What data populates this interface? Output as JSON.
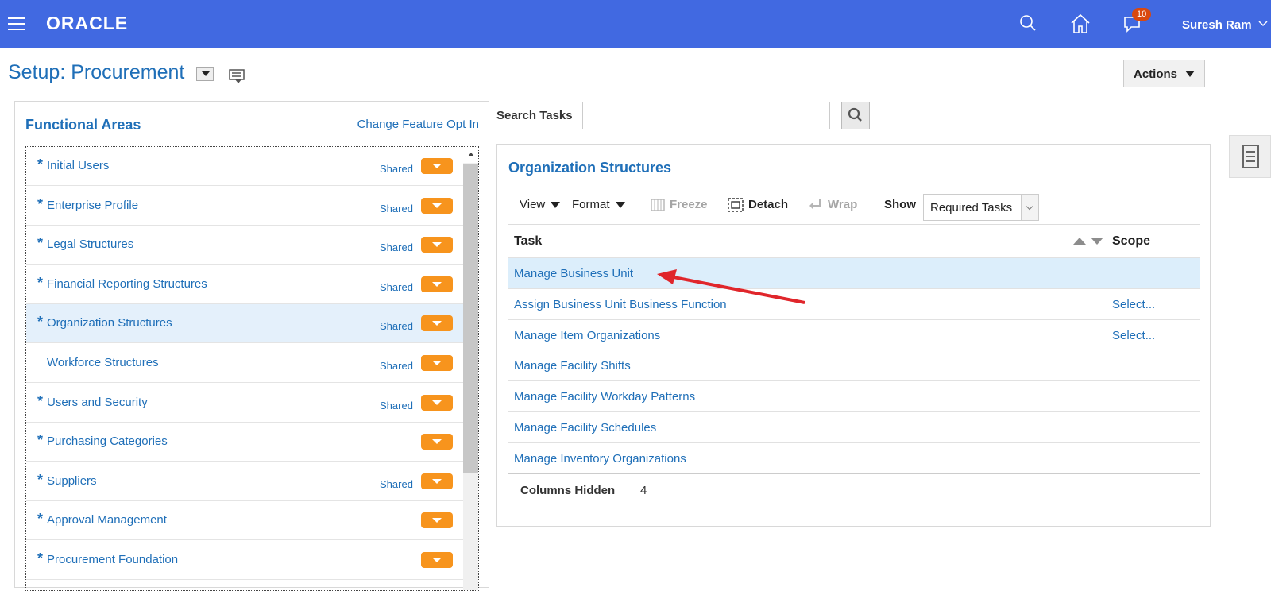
{
  "header": {
    "brand": "ORACLE",
    "notification_count": "10",
    "user_name": "Suresh Ram"
  },
  "page": {
    "title": "Setup: Procurement",
    "actions_label": "Actions"
  },
  "functional_areas": {
    "title": "Functional Areas",
    "change_link": "Change Feature Opt In",
    "items": [
      {
        "label": "Initial Users",
        "required": "*",
        "shared": "Shared"
      },
      {
        "label": "Enterprise Profile",
        "required": "*",
        "shared": "Shared"
      },
      {
        "label": "Legal Structures",
        "required": "*",
        "shared": "Shared"
      },
      {
        "label": "Financial Reporting Structures",
        "required": "*",
        "shared": "Shared"
      },
      {
        "label": "Organization Structures",
        "required": "*",
        "shared": "Shared",
        "selected": true
      },
      {
        "label": "Workforce Structures",
        "required": "",
        "shared": "Shared"
      },
      {
        "label": "Users and Security",
        "required": "*",
        "shared": "Shared"
      },
      {
        "label": "Purchasing Categories",
        "required": "*",
        "shared": ""
      },
      {
        "label": "Suppliers",
        "required": "*",
        "shared": "Shared"
      },
      {
        "label": "Approval Management",
        "required": "*",
        "shared": ""
      },
      {
        "label": "Procurement Foundation",
        "required": "*",
        "shared": ""
      }
    ]
  },
  "search": {
    "label": "Search Tasks",
    "value": ""
  },
  "org_structures": {
    "title": "Organization Structures",
    "toolbar": {
      "view": "View",
      "format": "Format",
      "freeze": "Freeze",
      "detach": "Detach",
      "wrap": "Wrap",
      "show": "Show",
      "show_value": "Required Tasks"
    },
    "columns": {
      "task": "Task",
      "scope": "Scope"
    },
    "rows": [
      {
        "task": "Manage Business Unit",
        "scope": ""
      },
      {
        "task": "Assign Business Unit Business Function",
        "scope": "Select..."
      },
      {
        "task": "Manage Item Organizations",
        "scope": "Select..."
      },
      {
        "task": "Manage Facility Shifts",
        "scope": ""
      },
      {
        "task": "Manage Facility Workday Patterns",
        "scope": ""
      },
      {
        "task": "Manage Facility Schedules",
        "scope": ""
      },
      {
        "task": "Manage Inventory Organizations",
        "scope": ""
      }
    ],
    "columns_hidden_label": "Columns Hidden",
    "columns_hidden_value": "4"
  },
  "colors": {
    "header_bg": "#4169e1",
    "link": "#1f6fb8",
    "badge": "#f7941d",
    "annotation_arrow": "#e0262b"
  }
}
